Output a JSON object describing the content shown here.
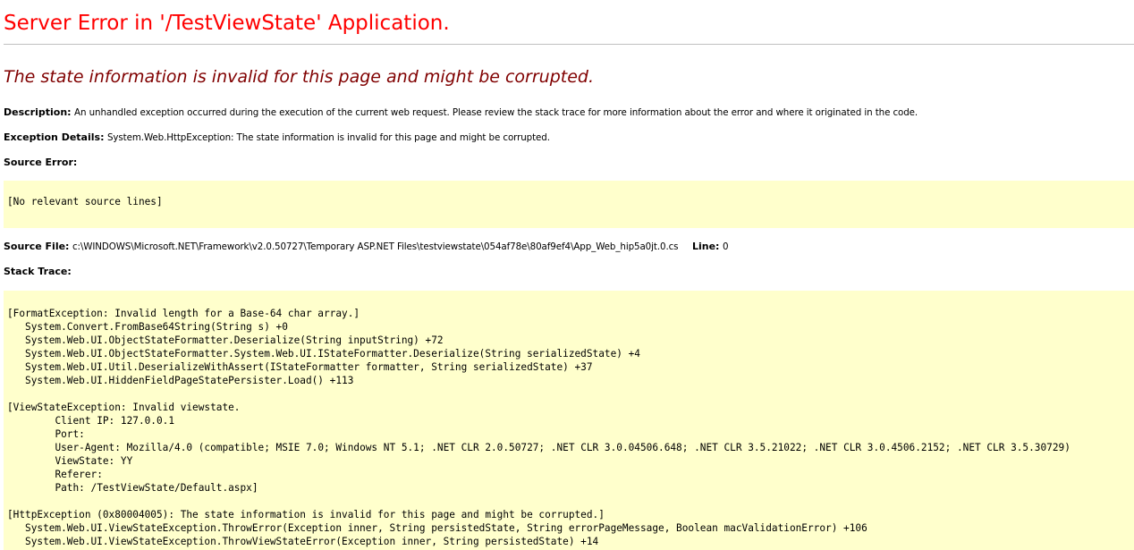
{
  "title": "Server Error in '/TestViewState' Application.",
  "subtitle": "The state information is invalid for this page and might be corrupted.",
  "description": {
    "label": "Description:",
    "text": "An unhandled exception occurred during the execution of the current web request. Please review the stack trace for more information about the error and where it originated in the code."
  },
  "exception_details": {
    "label": "Exception Details:",
    "text": "System.Web.HttpException: The state information is invalid for this page and might be corrupted."
  },
  "source_error": {
    "label": "Source Error:",
    "text": "[No relevant source lines]"
  },
  "source_file": {
    "label": "Source File:",
    "path": "c:\\WINDOWS\\Microsoft.NET\\Framework\\v2.0.50727\\Temporary ASP.NET Files\\testviewstate\\054af78e\\80af9ef4\\App_Web_hip5a0jt.0.cs",
    "line_label": "Line:",
    "line_value": "0"
  },
  "stack_trace": {
    "label": "Stack Trace:",
    "lines": [
      "[FormatException: Invalid length for a Base-64 char array.]",
      "   System.Convert.FromBase64String(String s) +0",
      "   System.Web.UI.ObjectStateFormatter.Deserialize(String inputString) +72",
      "   System.Web.UI.ObjectStateFormatter.System.Web.UI.IStateFormatter.Deserialize(String serializedState) +4",
      "   System.Web.UI.Util.DeserializeWithAssert(IStateFormatter formatter, String serializedState) +37",
      "   System.Web.UI.HiddenFieldPageStatePersister.Load() +113",
      "",
      "[ViewStateException: Invalid viewstate.",
      "\tClient IP: 127.0.0.1",
      "\tPort: ",
      "\tUser-Agent: Mozilla/4.0 (compatible; MSIE 7.0; Windows NT 5.1; .NET CLR 2.0.50727; .NET CLR 3.0.04506.648; .NET CLR 3.5.21022; .NET CLR 3.0.4506.2152; .NET CLR 3.5.30729)",
      "\tViewState: YY",
      "\tReferer: ",
      "\tPath: /TestViewState/Default.aspx]",
      "",
      "[HttpException (0x80004005): The state information is invalid for this page and might be corrupted.]",
      "   System.Web.UI.ViewStateException.ThrowError(Exception inner, String persistedState, String errorPageMessage, Boolean macValidationError) +106",
      "   System.Web.UI.ViewStateException.ThrowViewStateError(Exception inner, String persistedState) +14"
    ]
  }
}
